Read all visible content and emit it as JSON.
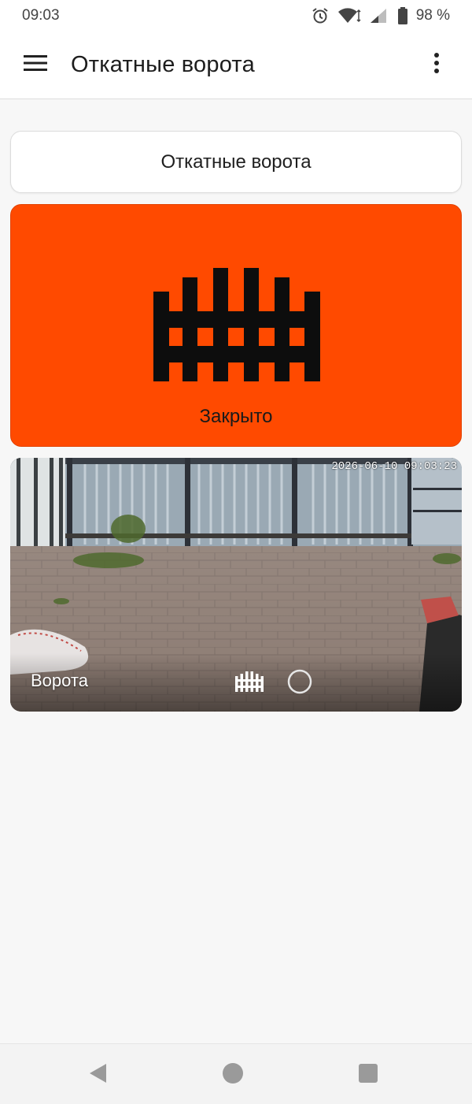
{
  "status_bar": {
    "time": "09:03",
    "battery": "98 %",
    "icons": [
      "alarm-icon",
      "wifi-icon",
      "signal-icon",
      "battery-icon"
    ]
  },
  "app_bar": {
    "title": "Откатные ворота",
    "icons": [
      "menu-icon",
      "more-vert-icon"
    ]
  },
  "title_card": {
    "label": "Откатные ворота"
  },
  "gate_card": {
    "status": "Закрыто",
    "icon": "fence-gate-icon",
    "background": "#ff4a00"
  },
  "camera": {
    "timestamp": "2026-06-10 09:03:23",
    "label": "Ворота",
    "icons": [
      "fence-gate-icon",
      "circle-icon"
    ]
  },
  "nav_bar": {
    "icons": [
      "back-icon",
      "home-icon",
      "recents-icon"
    ]
  }
}
